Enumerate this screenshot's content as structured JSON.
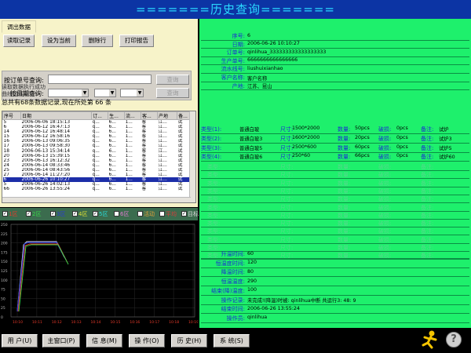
{
  "window": {
    "title": "=======历史查询======="
  },
  "left": {
    "tab_load": "调出数据",
    "toolbar": [
      "读取记录",
      "设为当前",
      "删除行",
      "打印报告"
    ],
    "query": {
      "by_order_label": "按订单号查询:",
      "by_date_label": "按日期查询:",
      "search_btn": "查询",
      "search_btn2": "查询"
    },
    "messages": [
      "读取数据执行成功",
      "曲线加载成功!"
    ],
    "summary": "总共有68条数据记录,现在所处第 66 条",
    "grid": {
      "headers": [
        "序号",
        "日期",
        "订...",
        "生...",
        "流...",
        "客...",
        "产地",
        "备..."
      ],
      "rows": [
        [
          "5",
          "2006-06-06 18:15:13",
          "q...",
          "6...",
          "1...",
          "客",
          "江...",
          "试"
        ],
        [
          "6",
          "2006-06-12 16:47:13",
          "q...",
          "6...",
          "1...",
          "客",
          "江...",
          "试"
        ],
        [
          "14",
          "2006-06-12 16:48:14",
          "q...",
          "6...",
          "1...",
          "客",
          "江...",
          "试"
        ],
        [
          "15",
          "2006-06-12 16:58:16",
          "q...",
          "6...",
          "1...",
          "客",
          "江...",
          "试"
        ],
        [
          "16",
          "2006-06-13 09:06:35",
          "q...",
          "6...",
          "1...",
          "客",
          "江...",
          "试"
        ],
        [
          "17",
          "2006-06-13 09:58:30",
          "q...",
          "6...",
          "1...",
          "客",
          "江...",
          "试"
        ],
        [
          "18",
          "2006-06-13 15:34:14",
          "q...",
          "6...",
          "1...",
          "客",
          "江...",
          "试"
        ],
        [
          "20",
          "2006-06-13 15:39:15",
          "q...",
          "6...",
          "1...",
          "客",
          "江...",
          "试"
        ],
        [
          "23",
          "2006-06-13 16:12:32",
          "q...",
          "6...",
          "1...",
          "客",
          "江...",
          "试"
        ],
        [
          "24",
          "2006-06-14 08:33:46",
          "q...",
          "6...",
          "1...",
          "客",
          "江...",
          "试"
        ],
        [
          "25",
          "2006-06-14 08:43:56",
          "q...",
          "6...",
          "1...",
          "客",
          "江...",
          "试"
        ],
        [
          "27",
          "2006-06-14 11:27:20",
          "q...",
          "6...",
          "1...",
          "客",
          "江...",
          "试"
        ],
        [
          "6",
          "2006-06-26 10:10:27",
          "q...",
          "6...",
          "1...",
          "客",
          "江...",
          "试"
        ],
        [
          "5",
          "2006-06-26 14:02:13",
          "q...",
          "6...",
          "1...",
          "客",
          "江...",
          "试"
        ],
        [
          "66",
          "2006-06-26 13:55:24",
          "q...",
          "6...",
          "1...",
          "客",
          "江...",
          "试"
        ]
      ],
      "selected_row": 12
    },
    "legend": [
      {
        "label": "1区",
        "checked": true,
        "color": "#e83a2a"
      },
      {
        "label": "2区",
        "checked": true,
        "color": "#3ad94a"
      },
      {
        "label": "3区",
        "checked": true,
        "color": "#2a3ad9"
      },
      {
        "label": "4区",
        "checked": true,
        "color": "#e0e033"
      },
      {
        "label": "5区",
        "checked": true,
        "color": "#2adcd9"
      },
      {
        "label": "6区",
        "checked": false,
        "color": "#e07ad0"
      },
      {
        "label": "活动",
        "checked": false,
        "color": "#e0a03a"
      },
      {
        "label": "平均",
        "checked": false,
        "color": "#e03a3a"
      },
      {
        "label": "目标",
        "checked": true,
        "color": "#dddddd"
      }
    ],
    "chart": {
      "yticks": [
        "250",
        "225",
        "200",
        "175",
        "150",
        "125",
        "100",
        "75",
        "50",
        "25",
        "0"
      ],
      "xticks": [
        "10:10",
        "10:11",
        "10:12",
        "10:13",
        "10:14",
        "10:15",
        "10:16",
        "10:17",
        "10:18",
        "10:19"
      ]
    }
  },
  "right": {
    "info": [
      {
        "label": "序号:",
        "value": "6"
      },
      {
        "label": "日期:",
        "value": "2006-06-26 10:10:27"
      },
      {
        "label": "订单号:",
        "value": "qinlihua_333333333333333333"
      },
      {
        "label": "生产单号:",
        "value": "6666666666666666"
      },
      {
        "label": "流水线号:",
        "value": "liushuixianhao"
      },
      {
        "label": "客户名称:",
        "value": "客户名称"
      },
      {
        "label": "产地:",
        "value": "江苏、昆山"
      }
    ],
    "types": [
      {
        "label": "类型(1):",
        "name": "普通白玻",
        "size_label": "尺寸:",
        "size": "1500*2000",
        "qty_label": "数量:",
        "qty": "50pcs",
        "broken_label": "破损:",
        "broken": "0pcs",
        "note_label": "备注:",
        "note": "试炉"
      },
      {
        "label": "类型(2):",
        "name": "普通白玻3",
        "size_label": "尺寸:",
        "size": "1600*2000",
        "qty_label": "数量:",
        "qty": "20pcs",
        "broken_label": "破损:",
        "broken": "0pcs",
        "note_label": "备注:",
        "note": "试炉3"
      },
      {
        "label": "类型(3):",
        "name": "普通白玻5",
        "size_label": "尺寸:",
        "size": "2500*600",
        "qty_label": "数量:",
        "qty": "60pcs",
        "broken_label": "破损:",
        "broken": "0pcs",
        "note_label": "备注:",
        "note": "试炉5"
      },
      {
        "label": "类型(4):",
        "name": "普通白玻6",
        "size_label": "尺寸:",
        "size": "250*60",
        "qty_label": "数量:",
        "qty": "66pcs",
        "broken_label": "破损:",
        "broken": "0pcs",
        "note_label": "备注:",
        "note": "试炉60"
      }
    ],
    "empty_row": {
      "label": "类型:",
      "size_label": "尺寸:",
      "qty_label": "数量:",
      "broken_label": "破损:",
      "note_label": "备注:"
    },
    "process": [
      {
        "label": "升温时间:",
        "value": "60"
      },
      {
        "label": "恒温度时间:",
        "value": "120"
      },
      {
        "label": "降温时间:",
        "value": "80"
      },
      {
        "label": "恒温温度:",
        "value": "290"
      },
      {
        "label": "结束(降)温度:",
        "value": "100"
      },
      {
        "label": "操作记录:",
        "value": "未完成!(降温)时被: qinlihua中断 共运行3: 48: 9"
      },
      {
        "label": "结束时间:",
        "value": "2006-06-26 13:55:24"
      },
      {
        "label": "操作员:",
        "value": "qinlihua"
      }
    ]
  },
  "bottom": {
    "buttons": [
      "用 户(U)",
      "主窗口(P)",
      "信 息(M)",
      "操 作(O)",
      "历 史(H)",
      "系 统(S)"
    ],
    "icons": [
      "running-man-icon",
      "help-icon"
    ]
  }
}
